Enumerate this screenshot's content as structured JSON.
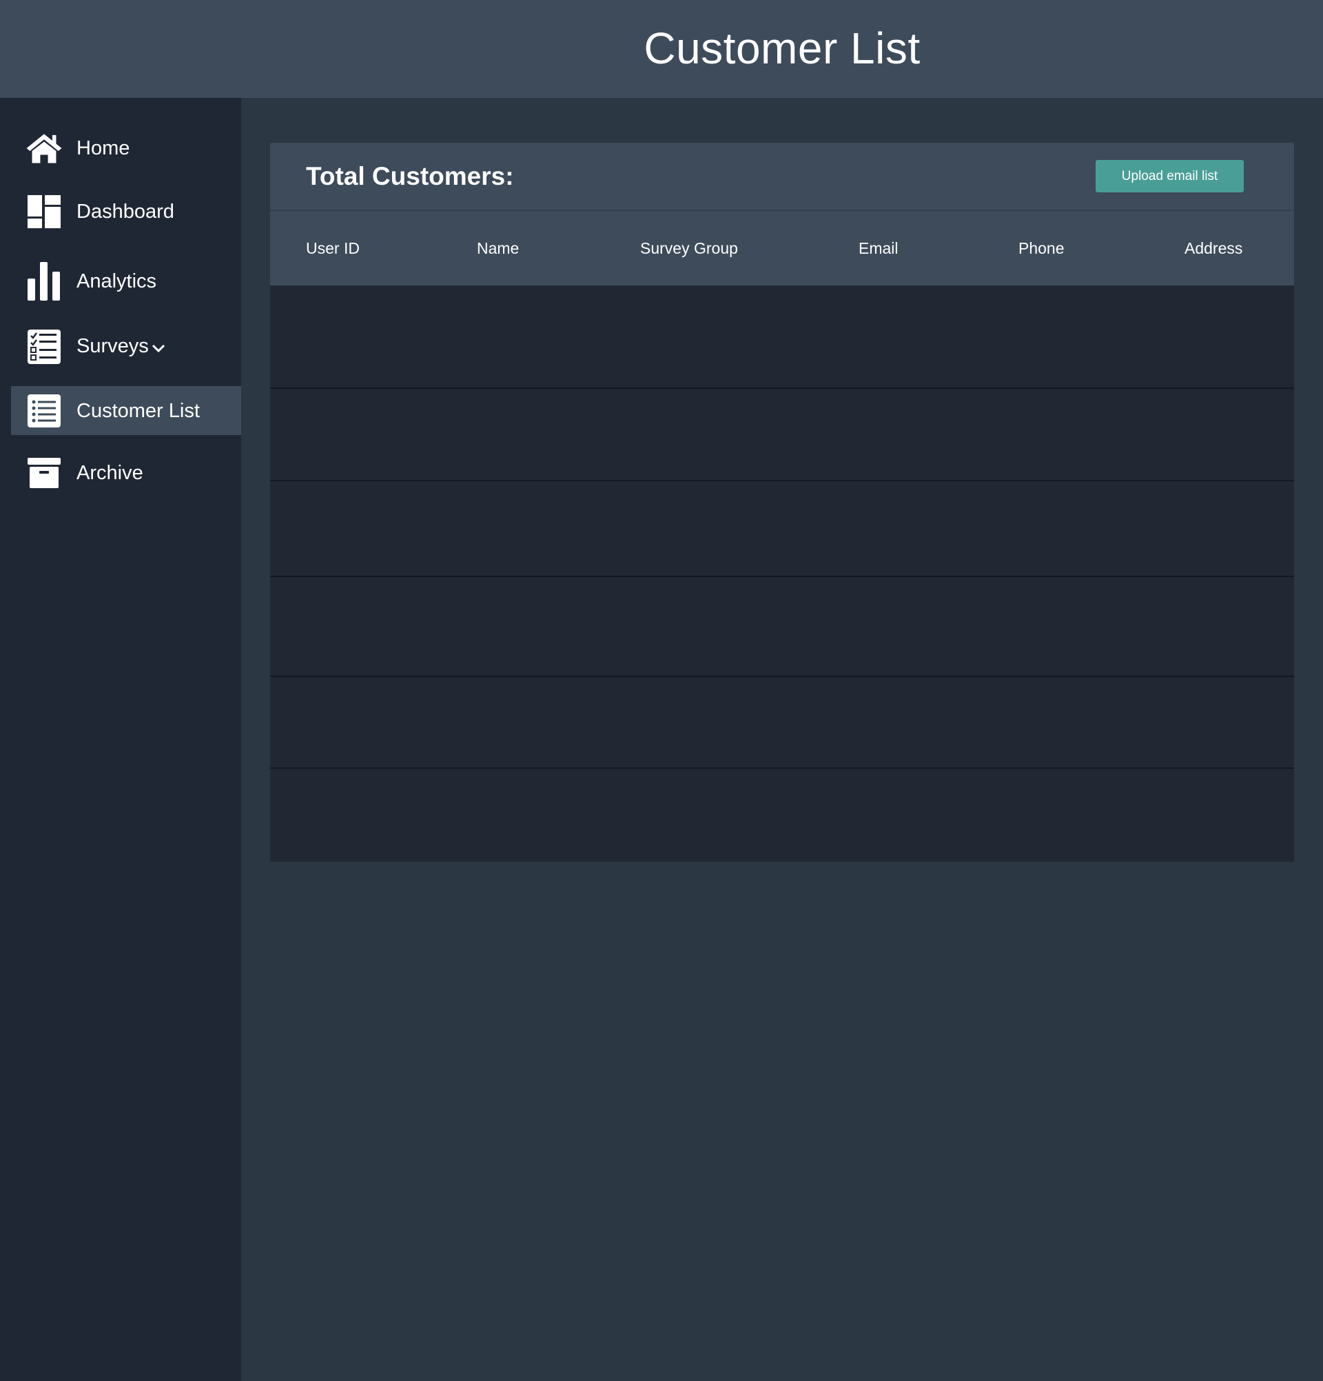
{
  "header": {
    "title": "Customer List"
  },
  "sidebar": {
    "items": [
      {
        "label": "Home",
        "icon": "home-icon"
      },
      {
        "label": "Dashboard",
        "icon": "dashboard-icon"
      },
      {
        "label": "Analytics",
        "icon": "bar-chart-icon"
      },
      {
        "label": "Surveys",
        "icon": "checklist-icon",
        "dropdown": true
      },
      {
        "label": "Customer List",
        "icon": "list-icon",
        "active": true
      },
      {
        "label": "Archive",
        "icon": "archive-icon"
      }
    ]
  },
  "panel": {
    "title": "Total Customers:",
    "upload_label": "Upload email list",
    "columns": [
      "User ID",
      "Name",
      "Survey Group",
      "Email",
      "Phone",
      "Address"
    ],
    "rows": [
      {
        "user_id": "",
        "name": "",
        "survey_group": "",
        "email": "",
        "phone": "",
        "address": ""
      },
      {
        "user_id": "",
        "name": "",
        "survey_group": "",
        "email": "",
        "phone": "",
        "address": ""
      },
      {
        "user_id": "",
        "name": "",
        "survey_group": "",
        "email": "",
        "phone": "",
        "address": ""
      },
      {
        "user_id": "",
        "name": "",
        "survey_group": "",
        "email": "",
        "phone": "",
        "address": ""
      },
      {
        "user_id": "",
        "name": "",
        "survey_group": "",
        "email": "",
        "phone": "",
        "address": ""
      },
      {
        "user_id": "",
        "name": "",
        "survey_group": "",
        "email": "",
        "phone": "",
        "address": ""
      }
    ]
  },
  "colors": {
    "background": "#2c3744",
    "topbar": "#3e4b5a",
    "sidebar": "#202734",
    "table_body": "#212834",
    "accent": "#4a9e98",
    "text": "#ffffff"
  }
}
